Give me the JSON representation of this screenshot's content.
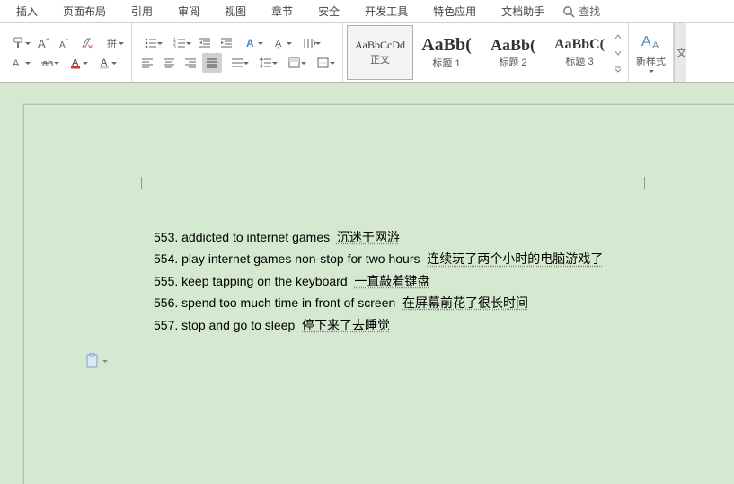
{
  "tabs": [
    "插入",
    "页面布局",
    "引用",
    "审阅",
    "视图",
    "章节",
    "安全",
    "开发工具",
    "特色应用",
    "文档助手"
  ],
  "search_label": "查找",
  "styles": {
    "items": [
      {
        "preview": "AaBbCcDd",
        "label": "正文",
        "size": "12px",
        "weight": "400"
      },
      {
        "preview": "AaBb(",
        "label": "标题 1",
        "size": "20px",
        "weight": "700"
      },
      {
        "preview": "AaBb(",
        "label": "标题 2",
        "size": "18px",
        "weight": "700"
      },
      {
        "preview": "AaBbC(",
        "label": "标题 3",
        "size": "16px",
        "weight": "700"
      }
    ],
    "new_style_label": "新样式"
  },
  "document": {
    "lines": [
      {
        "n": "553.",
        "en": "addicted to internet games",
        "cn": "沉迷于网游"
      },
      {
        "n": "554.",
        "en": "play internet games non-stop for two hours",
        "cn": "连续玩了两个小时的电脑游戏了"
      },
      {
        "n": "555.",
        "en": "keep tapping on the keyboard",
        "cn": "一直敲着键盘"
      },
      {
        "n": "556.",
        "en": "spend too much time in front of screen",
        "cn": "在屏幕前花了很长时间"
      },
      {
        "n": "557.",
        "en": "stop and go to sleep",
        "cn": "停下来了去睡觉"
      }
    ]
  }
}
